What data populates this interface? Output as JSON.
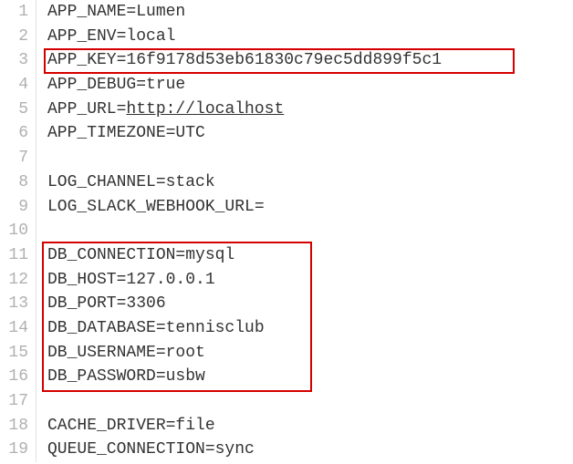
{
  "lineNumbers": [
    "1",
    "2",
    "3",
    "4",
    "5",
    "6",
    "7",
    "8",
    "9",
    "10",
    "11",
    "12",
    "13",
    "14",
    "15",
    "16",
    "17",
    "18",
    "19"
  ],
  "lines": {
    "l1": "APP_NAME=Lumen",
    "l2": "APP_ENV=local",
    "l3": "APP_KEY=16f9178d53eb61830c79ec5dd899f5c1",
    "l4": "APP_DEBUG=true",
    "l5_prefix": "APP_URL=",
    "l5_url": "http://localhost",
    "l6": "APP_TIMEZONE=UTC",
    "l7": "",
    "l8": "LOG_CHANNEL=stack",
    "l9": "LOG_SLACK_WEBHOOK_URL=",
    "l10": "",
    "l11": "DB_CONNECTION=mysql",
    "l12": "DB_HOST=127.0.0.1",
    "l13": "DB_PORT=3306",
    "l14": "DB_DATABASE=tennisclub",
    "l15": "DB_USERNAME=root",
    "l16": "DB_PASSWORD=usbw",
    "l17": "",
    "l18": "CACHE_DRIVER=file",
    "l19": "QUEUE_CONNECTION=sync"
  }
}
